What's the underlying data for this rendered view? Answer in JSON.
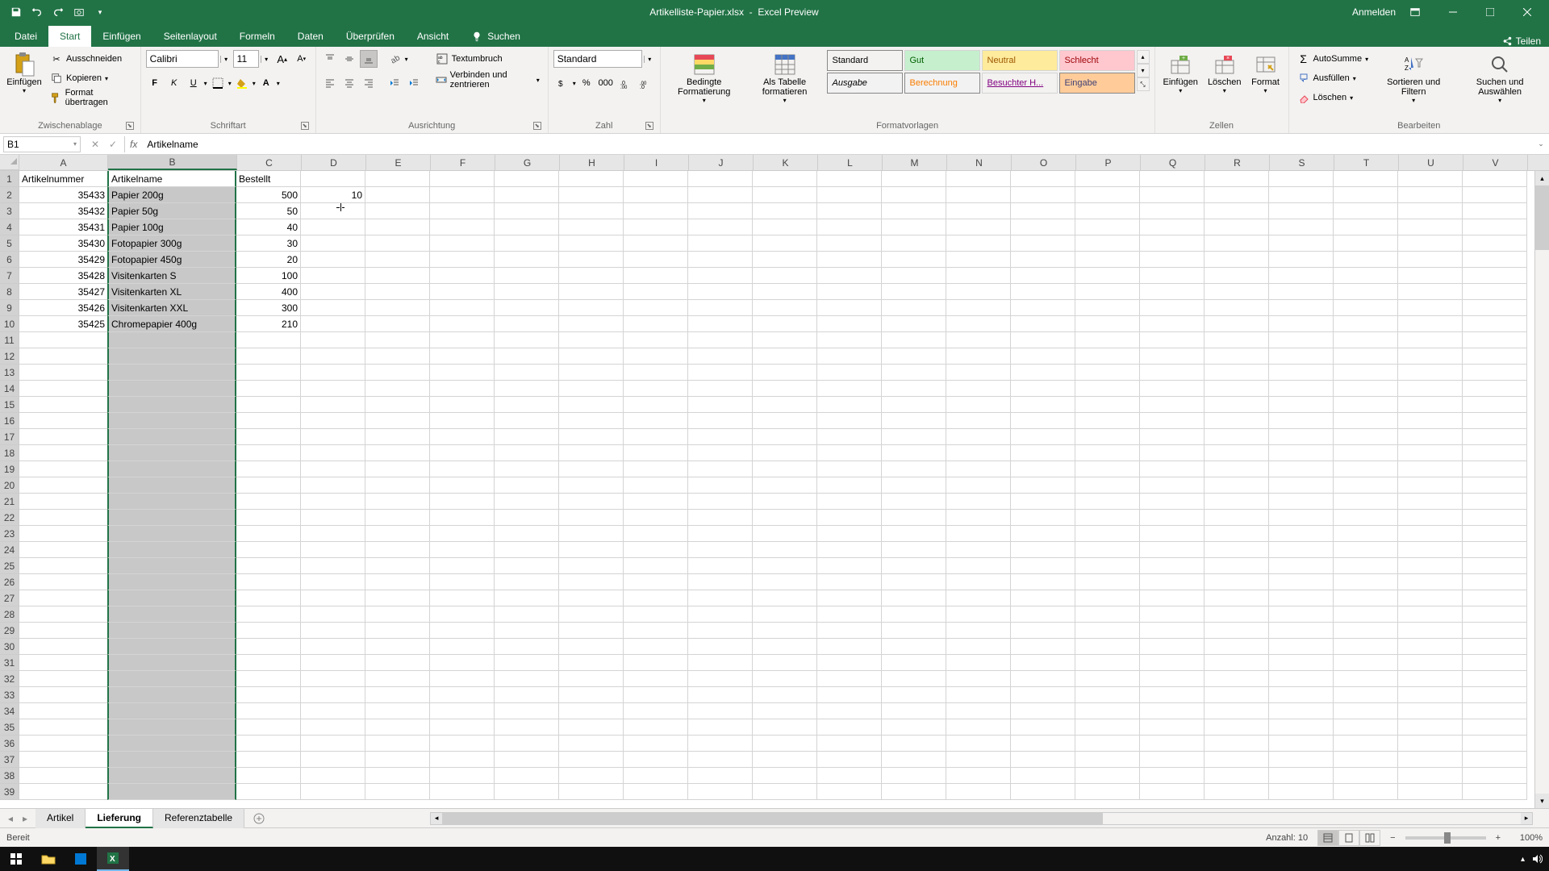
{
  "title": {
    "filename": "Artikelliste-Papier.xlsx",
    "suffix": "Excel Preview"
  },
  "account": {
    "signin": "Anmelden"
  },
  "tabs": {
    "file": "Datei",
    "home": "Start",
    "insert": "Einfügen",
    "pagelayout": "Seitenlayout",
    "formulas": "Formeln",
    "data": "Daten",
    "review": "Überprüfen",
    "view": "Ansicht",
    "search": "Suchen",
    "share": "Teilen"
  },
  "ribbon": {
    "clipboard": {
      "paste": "Einfügen",
      "cut": "Ausschneiden",
      "copy": "Kopieren",
      "formatpainter": "Format übertragen",
      "label": "Zwischenablage"
    },
    "font": {
      "name": "Calibri",
      "size": "11",
      "label": "Schriftart"
    },
    "alignment": {
      "wrap": "Textumbruch",
      "merge": "Verbinden und zentrieren",
      "label": "Ausrichtung"
    },
    "number": {
      "format": "Standard",
      "label": "Zahl"
    },
    "styles": {
      "condformat": "Bedingte Formatierung",
      "astable": "Als Tabelle formatieren",
      "s_standard": "Standard",
      "s_gut": "Gut",
      "s_neutral": "Neutral",
      "s_schlecht": "Schlecht",
      "s_ausgabe": "Ausgabe",
      "s_berechnung": "Berechnung",
      "s_besuchter": "Besuchter H...",
      "s_eingabe": "Eingabe",
      "label": "Formatvorlagen"
    },
    "cells": {
      "insert": "Einfügen",
      "delete": "Löschen",
      "format": "Format",
      "label": "Zellen"
    },
    "editing": {
      "autosum": "AutoSumme",
      "fill": "Ausfüllen",
      "clear": "Löschen",
      "sortfilter": "Sortieren und Filtern",
      "findselect": "Suchen und Auswählen",
      "label": "Bearbeiten"
    }
  },
  "formula_bar": {
    "name_box": "B1",
    "formula": "Artikelname"
  },
  "columns": [
    "A",
    "B",
    "C",
    "D",
    "E",
    "F",
    "G",
    "H",
    "I",
    "J",
    "K",
    "L",
    "M",
    "N",
    "O",
    "P",
    "Q",
    "R",
    "S",
    "T",
    "U",
    "V"
  ],
  "col_widths": {
    "A": 110,
    "B": 160,
    "C": 80,
    "D": 80,
    "default": 80
  },
  "selected_column_index": 1,
  "headers": {
    "A": "Artikelnummer",
    "B": "Artikelname",
    "C": "Bestellt"
  },
  "rows": [
    {
      "A": "35433",
      "B": "Papier 200g",
      "C": "500",
      "D": "10"
    },
    {
      "A": "35432",
      "B": "Papier 50g",
      "C": "50"
    },
    {
      "A": "35431",
      "B": "Papier 100g",
      "C": "40"
    },
    {
      "A": "35430",
      "B": "Fotopapier 300g",
      "C": "30"
    },
    {
      "A": "35429",
      "B": "Fotopapier 450g",
      "C": "20"
    },
    {
      "A": "35428",
      "B": "Visitenkarten S",
      "C": "100"
    },
    {
      "A": "35427",
      "B": "Visitenkarten XL",
      "C": "400"
    },
    {
      "A": "35426",
      "B": "Visitenkarten XXL",
      "C": "300"
    },
    {
      "A": "35425",
      "B": "Chromepapier 400g",
      "C": "210"
    }
  ],
  "total_rows": 39,
  "sheets": {
    "tabs": [
      "Artikel",
      "Lieferung",
      "Referenztabelle"
    ],
    "active": 1
  },
  "status": {
    "ready": "Bereit",
    "count_label": "Anzahl:",
    "count_value": "10",
    "zoom": "100%"
  }
}
